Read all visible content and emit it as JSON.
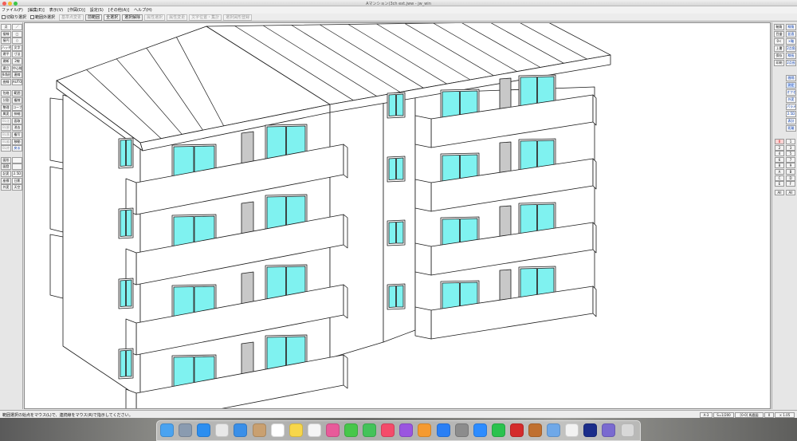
{
  "window": {
    "title": "Aマンション(3ch ext.jww - jw_win"
  },
  "menu": [
    "ファイル(F)",
    "[編集(E)]",
    "表示(V)",
    "[作図(D)]",
    "設定(S)",
    "[その他(A)]",
    "ヘルプ(H)"
  ],
  "toolbar": {
    "checkboxes": [
      "切取り選択",
      "範囲外選択"
    ],
    "buttons": [
      {
        "label": "基準点変更",
        "enabled": false
      },
      {
        "label": "前範囲",
        "enabled": true
      },
      {
        "label": "全選択",
        "enabled": true
      },
      {
        "label": "選択解除",
        "enabled": true
      },
      {
        "label": "属性選択",
        "enabled": false
      },
      {
        "label": "属性変更",
        "enabled": false
      },
      {
        "label": "文字位置・集計",
        "enabled": false
      },
      {
        "label": "選択図形登録",
        "enabled": false
      }
    ]
  },
  "left_tools": [
    [
      "点",
      "／"
    ],
    [
      "接線",
      "□"
    ],
    [
      "接円",
      "○"
    ],
    [
      "ハッチ",
      "文字"
    ],
    [
      "建平",
      "寸法"
    ],
    [
      "建断",
      "2線"
    ],
    [
      "建立",
      "中心線"
    ],
    [
      "多角形",
      "連線"
    ],
    [
      "曲線",
      "AUTO"
    ],
    [
      "包絡",
      "範囲"
    ],
    [
      "分割",
      "複線"
    ],
    [
      "整理",
      "コーナー"
    ],
    [
      "属変",
      "伸縮"
    ],
    [
      "BL化",
      "面取"
    ],
    [
      "BL解",
      "消去"
    ],
    [
      "BL属",
      "複写"
    ],
    [
      "BL編",
      "移動"
    ],
    [
      "BL終",
      "戻る"
    ],
    [
      "図形",
      ""
    ],
    [
      "図登",
      ""
    ],
    [
      "記変",
      "2.5D"
    ],
    [
      "座標",
      "日影"
    ],
    [
      "外変",
      "天空"
    ]
  ],
  "right_tools": [
    [
      "軸角",
      "線角"
    ],
    [
      "目盛",
      "鉛直"
    ],
    [
      "0<",
      "×軸"
    ],
    [
      "上書",
      "2点角"
    ],
    [
      "保存",
      "線長"
    ],
    [
      "印刷",
      "2点長"
    ],
    [
      "",
      "間隔"
    ],
    [
      "",
      "測定"
    ],
    [
      "",
      "オフセット"
    ],
    [
      "",
      "外変"
    ],
    [
      "",
      "パラメ"
    ],
    [
      "",
      "2.5D"
    ],
    [
      "",
      "表計"
    ],
    [
      "",
      "距離"
    ]
  ],
  "layers": [
    "0",
    "1",
    "2",
    "3",
    "4",
    "5",
    "6",
    "7",
    "8",
    "9",
    "A",
    "B",
    "C",
    "D",
    "E",
    "F"
  ],
  "layer_labels": [
    "All",
    "All"
  ],
  "status": {
    "hint": "範囲選択の始点をマウス(L)で、連続線をマウス(R)で指示してください。",
    "paper": "A-3",
    "scale": "S=1/200",
    "layer": "[0-0] 馬鹿図",
    "angle": "0",
    "zoom": "× 1.05"
  },
  "dock_apps": [
    "finder",
    "launchpad",
    "safari",
    "chrome",
    "mail",
    "contacts",
    "calendar",
    "notes",
    "reminders",
    "photos",
    "messages",
    "facetime",
    "music",
    "podcasts",
    "books",
    "app-store",
    "system-preferences",
    "zoom",
    "line",
    "acrobat",
    "game",
    "preview",
    "textedit",
    "jww",
    "other",
    "trash"
  ],
  "colors": {
    "glass": "#7ff2f0",
    "frame": "#1a1a1a",
    "shadow": "#c8c8c8"
  }
}
